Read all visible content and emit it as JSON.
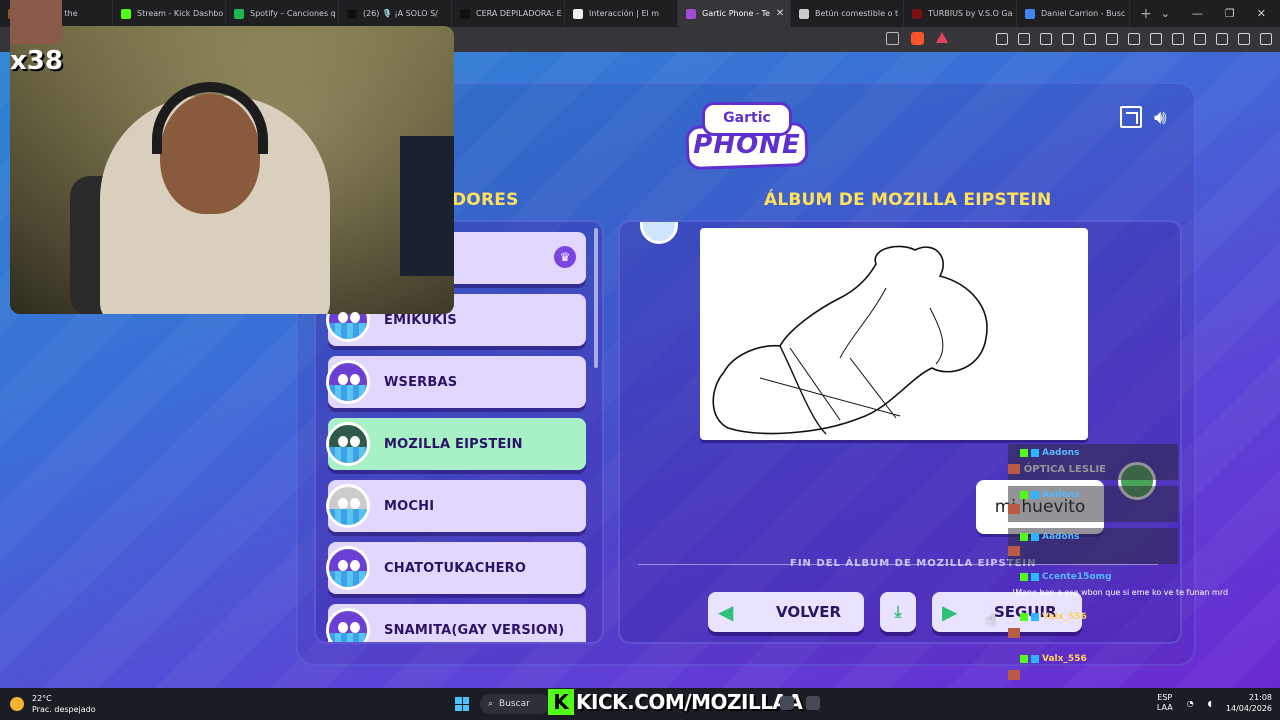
{
  "browser": {
    "tabs": [
      {
        "label": "...c under the",
        "color": "#8a5a2a"
      },
      {
        "label": "Stream - Kick Dashbo",
        "color": "#53fc18"
      },
      {
        "label": "Spotify – Canciones q",
        "color": "#1db954"
      },
      {
        "label": "(26) 🎙️ ¡A SOLO S/",
        "color": "#111111"
      },
      {
        "label": "CERA DEPILADORA: E",
        "color": "#111111"
      },
      {
        "label": "Interacción | El m",
        "color": "#eeeeee"
      },
      {
        "label": "Gartic Phone - Te",
        "color": "#a04ad8"
      },
      {
        "label": "Betún comestible o t",
        "color": "#cccccc"
      },
      {
        "label": "TURBIUS by V.S.O Ga",
        "color": "#7a1010"
      },
      {
        "label": "Daniel Carrion - Busc",
        "color": "#4285f4"
      }
    ],
    "new_tab": "+"
  },
  "game": {
    "logo_top": "Gartic",
    "logo_bottom": "PHONE",
    "players_heading": "DORES",
    "album_heading": "ÁLBUM DE MOZILLA EIPSTEIN",
    "players": [
      {
        "name": "",
        "host": true
      },
      {
        "name": "EMIKUKIS"
      },
      {
        "name": "WSERBAS"
      },
      {
        "name": "MOZILLA EIPSTEIN",
        "active": true
      },
      {
        "name": "MOCHI"
      },
      {
        "name": "CHATOTUKACHERO"
      },
      {
        "name": "SNAMITA(GAY VERSION)"
      }
    ],
    "guess_author": "KI ÓPTICA LESLIE",
    "guess_text": "mi huevito",
    "end_label": "FIN DEL ÁLBUM DE MOZILLA EIPSTEIN",
    "btn_back": "VOLVER",
    "btn_next": "SEGUIR",
    "colors": {
      "heading": "#ffe15a",
      "card": "#e2d7ff",
      "card_active": "#a8f0c6",
      "accent_green": "#2fc07a"
    }
  },
  "stream": {
    "emote_count": "x38",
    "kick_url": "KICK.COM/MOZILLAA",
    "kick_letter": "K"
  },
  "chat": {
    "users": [
      "Aadons",
      "Aadons",
      "Aadons",
      "Ccente15omg",
      "Valx_556",
      "Valx_556",
      "chato135"
    ],
    "message": "!Mano ban a ese wbon que si eme ko ve te funan mrd"
  },
  "taskbar": {
    "temp": "22°C",
    "weather": "Prac. despejado",
    "search": "Buscar",
    "lang1": "ESP",
    "lang2": "LAA",
    "time": "21:08",
    "date": "14/04/2026"
  }
}
